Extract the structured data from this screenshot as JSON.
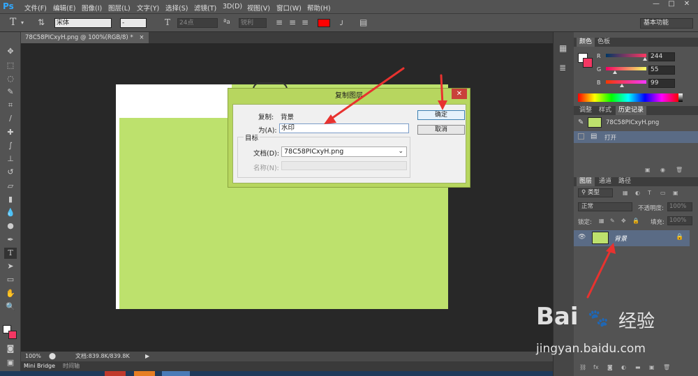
{
  "app": {
    "logo": "Ps"
  },
  "menu": [
    "文件(F)",
    "编辑(E)",
    "图像(I)",
    "图层(L)",
    "文字(Y)",
    "选择(S)",
    "滤镜(T)",
    "3D(D)",
    "视图(V)",
    "窗口(W)",
    "帮助(H)"
  ],
  "window_buttons": [
    "—",
    "□",
    "✕"
  ],
  "options": {
    "font_family": "宋体",
    "font_style": "-",
    "font_size": "24点",
    "aa_label": "ªa",
    "aa_mode": "锐利",
    "color": "#ff0000",
    "workspace": "基本功能"
  },
  "document_tab": "78C58PICxyH.png @ 100%(RGB/8) *",
  "document_tab_close": "×",
  "status": {
    "zoom": "100%",
    "doc_size": "文档:839.8K/839.8K"
  },
  "bottom_tabs": [
    "Mini Bridge",
    "时间轴"
  ],
  "color_panel": {
    "tabs": [
      "颜色",
      "色板"
    ],
    "r_label": "R",
    "g_label": "G",
    "b_label": "B",
    "r": "244",
    "g": "55",
    "b": "99",
    "r_fraction": 0.957,
    "g_fraction": 0.216,
    "b_fraction": 0.388,
    "fg_color": "#ffffff",
    "bg_color": "#f43763"
  },
  "history_panel": {
    "tabs": [
      "调整",
      "样式",
      "历史记录"
    ],
    "snapshot": "78C58PICxyH.png",
    "items": [
      "打开"
    ]
  },
  "layers_panel": {
    "tabs": [
      "图层",
      "通道",
      "路径"
    ],
    "filter_kind": "类型",
    "blend_mode": "正常",
    "opacity_label": "不透明度:",
    "opacity": "100%",
    "lock_label": "锁定:",
    "fill_label": "填充:",
    "fill": "100%",
    "layers": [
      {
        "name": "背景",
        "visible_icon": "👁"
      }
    ]
  },
  "dialog": {
    "title": "复制图层",
    "close": "✕",
    "duplicate_label": "复制:",
    "duplicate_value": "背景",
    "as_label": "为(A):",
    "as_value": "水印",
    "ok": "确定",
    "cancel": "取消",
    "target_group": "目标",
    "document_label": "文档(D):",
    "document_value": "78C58PICxyH.png",
    "name_label": "名称(N):",
    "name_value": ""
  },
  "watermark": {
    "brand": "Bai",
    "brand_suffix": "经验",
    "url": "jingyan.baidu.com"
  }
}
